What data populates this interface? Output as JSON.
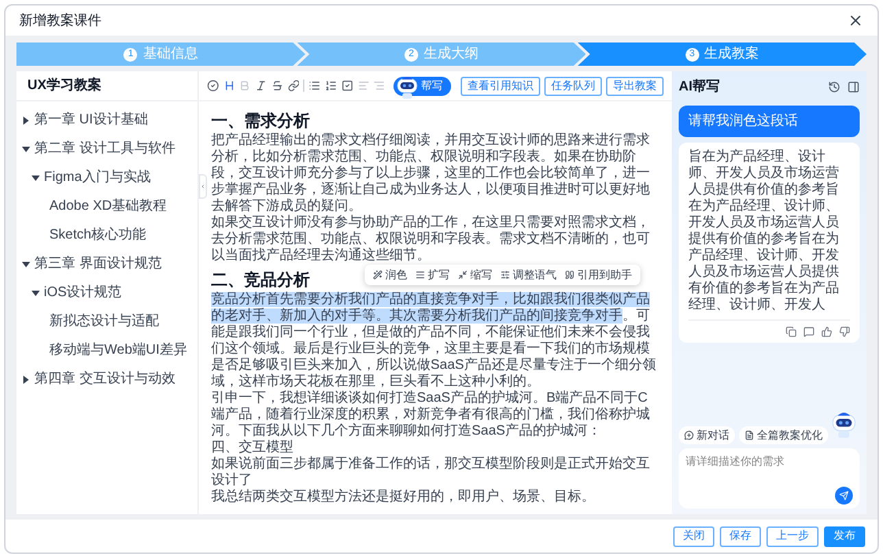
{
  "window": {
    "title": "新增教案课件"
  },
  "steps": [
    {
      "number": "1",
      "label": "基础信息",
      "selected": false
    },
    {
      "number": "2",
      "label": "生成大纲",
      "selected": false
    },
    {
      "number": "3",
      "label": "生成教案",
      "selected": true
    }
  ],
  "outline": {
    "title": "UX学习教案",
    "items": [
      {
        "label": "第一章 UI设计基础",
        "expanded": false
      },
      {
        "label": "第二章 设计工具与软件",
        "expanded": true,
        "children": [
          {
            "label": "Figma入门与实战",
            "expanded": true,
            "children": [
              {
                "label": "Adobe XD基础教程"
              },
              {
                "label": "Sketch核心功能"
              }
            ]
          }
        ]
      },
      {
        "label": "第三章 界面设计规范",
        "expanded": true,
        "children": [
          {
            "label": "iOS设计规范",
            "expanded": true,
            "children": [
              {
                "label": "新拟态设计与适配"
              },
              {
                "label": "移动端与Web端UI差异"
              }
            ]
          }
        ]
      },
      {
        "label": "第四章 交互设计与动效",
        "expanded": false
      }
    ]
  },
  "editor": {
    "ai_badge": "帮写",
    "buttons": [
      "查看引用知识",
      "任务队列",
      "导出教案"
    ],
    "blocks": [
      {
        "kind": "heading",
        "text": "一、需求分析"
      },
      {
        "kind": "paragraph",
        "text": "把产品经理输出的需求文档仔细阅读，并用交互设计师的思路来进行需求分析，比如分析需求范围、功能点、权限说明和字段表。如果在协助阶段，交互设计师充分参与了以上步骤，这里的工作也会比较简单了，进一步掌握产品业务，逐渐让自己成为业务达人，以便项目推进时可以更好地去解答下游成员的疑问。"
      },
      {
        "kind": "paragraph",
        "text": "如果交互设计师没有参与协助产品的工作，在这里只需要对照需求文档，去分析需求范围、功能点、权限说明和字段表。需求文档不清晰的，也可以当面找产品经理去沟通这些细节。"
      },
      {
        "kind": "heading",
        "text": "二、竞品分析",
        "menu": [
          "润色",
          "扩写",
          "缩写",
          "调整语气",
          "引用到助手"
        ]
      },
      {
        "kind": "paragraph",
        "selected_text": "竞品分析首先需要分析我们产品的直接竞争对手，比如跟我们很类似产品的老对手、新加入的对手等。其次需要分析我们产品的间接竞争对手",
        "text": "。可能是跟我们同一个行业，但是做的产品不同，不能保证他们未来不会侵我们这个领域。最后是行业巨头的竞争，这里主要是看一下我们的市场规模是否足够吸引巨头来加入，所以说做SaaS产品还是尽量专注于一个细分领域，这样市场天花板在那里，巨头看不上这种小利的。"
      },
      {
        "kind": "paragraph",
        "text": "引申一下，我想详细谈谈如何打造SaaS产品的护城河。B端产品不同于C端产品，随着行业深度的积累，对新竞争者有很高的门槛，我们俗称护城河。下面我从以下几个方面来聊聊如何打造SaaS产品的护城河："
      },
      {
        "kind": "paragraph",
        "text": "四、交互模型"
      },
      {
        "kind": "paragraph",
        "text": "如果说前面三步都属于准备工作的话，那交互模型阶段则是正式开始交互设计了"
      },
      {
        "kind": "paragraph",
        "text": "我总结两类交互模型方法还是挺好用的，即用户、场景、目标。"
      }
    ]
  },
  "assistant": {
    "title": "AI帮写",
    "user_message": "请帮我润色这段话",
    "reply": "旨在为产品经理、设计师、开发人员及市场运营人员提供有价值的参考旨在为产品经理、设计师、开发人员及市场运营人员提供有价值的参考旨在为产品经理、设计师、开发人员及市场运营人员提供有价值的参考旨在为产品经理、设计师、开发人",
    "chips": [
      "新对话",
      "全篇教案优化"
    ],
    "input": {
      "placeholder": "请详细描述你的需求"
    }
  },
  "footer": {
    "buttons": [
      {
        "label": "关闭",
        "primary": false
      },
      {
        "label": "保存",
        "primary": false
      },
      {
        "label": "上一步",
        "primary": false
      },
      {
        "label": "发布",
        "primary": true
      }
    ]
  }
}
